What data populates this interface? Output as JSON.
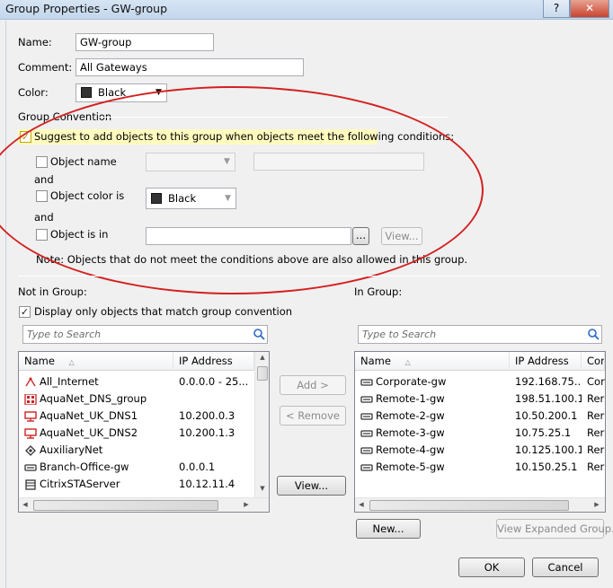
{
  "window": {
    "title": "Group Properties - GW-group",
    "help_label": "?",
    "close_label": "✕"
  },
  "form": {
    "name_label": "Name:",
    "name_value": "GW-group",
    "comment_label": "Comment:",
    "comment_value": "All Gateways",
    "color_label": "Color:",
    "color_value": "Black"
  },
  "convention": {
    "section_title": "Group Convention",
    "suggest_label": "Suggest to add objects to this group when objects meet the following conditions:",
    "object_name_label": "Object name",
    "and_1": "and",
    "object_color_label": "Object color is",
    "object_color_value": "Black",
    "and_2": "and",
    "object_is_in_label": "Object is in",
    "ellipsis_label": "...",
    "view_label": "View...",
    "note": "Note: Objects that do not meet the conditions above are also allowed in this group."
  },
  "not_in_group": {
    "title": "Not in Group:",
    "display_only_label": "Display only objects that match group convention",
    "search_placeholder": "Type to Search",
    "columns": {
      "name": "Name",
      "ip": "IP Address"
    },
    "rows": [
      {
        "name": "All_Internet",
        "ip": "0.0.0.0 - 25...",
        "icon": "network-range-icon"
      },
      {
        "name": "AquaNet_DNS_group",
        "ip": "",
        "icon": "group-icon"
      },
      {
        "name": "AquaNet_UK_DNS1",
        "ip": "10.200.0.3",
        "icon": "host-icon"
      },
      {
        "name": "AquaNet_UK_DNS2",
        "ip": "10.200.1.3",
        "icon": "host-icon"
      },
      {
        "name": "AuxiliaryNet",
        "ip": "",
        "icon": "network-icon"
      },
      {
        "name": "Branch-Office-gw",
        "ip": "0.0.0.1",
        "icon": "gateway-icon"
      },
      {
        "name": "CitrixSTAServer",
        "ip": "10.12.11.4",
        "icon": "server-icon"
      }
    ]
  },
  "middle": {
    "add_label": "Add >",
    "remove_label": "< Remove",
    "view_label": "View..."
  },
  "in_group": {
    "title": "In Group:",
    "search_placeholder": "Type to Search",
    "columns": {
      "name": "Name",
      "ip": "IP Address",
      "extra": "Cor"
    },
    "rows": [
      {
        "name": "Corporate-gw",
        "ip": "192.168.75....",
        "extra": "Cor"
      },
      {
        "name": "Remote-1-gw",
        "ip": "198.51.100.1",
        "extra": "Rer"
      },
      {
        "name": "Remote-2-gw",
        "ip": "10.50.200.1",
        "extra": "Rer"
      },
      {
        "name": "Remote-3-gw",
        "ip": "10.75.25.1",
        "extra": "Rer"
      },
      {
        "name": "Remote-4-gw",
        "ip": "10.125.100.1",
        "extra": "Rer"
      },
      {
        "name": "Remote-5-gw",
        "ip": "10.150.25.1",
        "extra": "Rer"
      }
    ],
    "new_label": "New...",
    "view_expanded_label": "View Expanded Group..."
  },
  "footer": {
    "ok_label": "OK",
    "cancel_label": "Cancel"
  },
  "colors": {
    "annotation": "#d42020",
    "host": "#cc1f1f"
  }
}
